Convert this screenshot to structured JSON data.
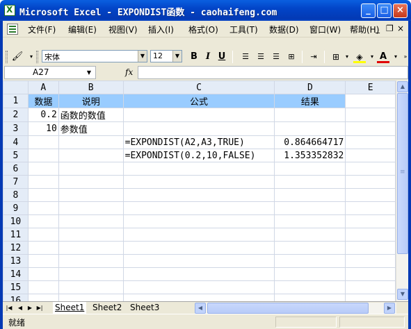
{
  "window": {
    "title": "Microsoft Excel - EXPONDIST函数 - caohaifeng.com",
    "minimize": "_",
    "maximize": "□",
    "close": "×"
  },
  "menu": {
    "items": [
      "文件(F)",
      "编辑(E)",
      "视图(V)",
      "插入(I)",
      "格式(O)",
      "工具(T)",
      "数据(D)",
      "窗口(W)",
      "帮助(H)"
    ],
    "doc_controls": [
      "_",
      "❐",
      "×"
    ]
  },
  "toolbar": {
    "font_name": "宋体",
    "font_size": "12",
    "bold": "B",
    "italic": "I",
    "underline": "U",
    "font_color_label": "A"
  },
  "formula_bar": {
    "name_box": "A27",
    "fx": "fx",
    "formula": ""
  },
  "sheet": {
    "columns": [
      "A",
      "B",
      "C",
      "D",
      "E"
    ],
    "rows": [
      [
        "数据",
        "说明",
        "公式",
        "结果",
        ""
      ],
      [
        "0.2",
        "函数的数值",
        "",
        "",
        ""
      ],
      [
        "10",
        "参数值",
        "",
        "",
        ""
      ],
      [
        "",
        "",
        "=EXPONDIST(A2,A3,TRUE)",
        "0.864664717",
        ""
      ],
      [
        "",
        "",
        "=EXPONDIST(0.2,10,FALSE)",
        "1.353352832",
        ""
      ],
      [
        "",
        "",
        "",
        "",
        ""
      ],
      [
        "",
        "",
        "",
        "",
        ""
      ],
      [
        "",
        "",
        "",
        "",
        ""
      ],
      [
        "",
        "",
        "",
        "",
        ""
      ],
      [
        "",
        "",
        "",
        "",
        ""
      ],
      [
        "",
        "",
        "",
        "",
        ""
      ],
      [
        "",
        "",
        "",
        "",
        ""
      ],
      [
        "",
        "",
        "",
        "",
        ""
      ],
      [
        "",
        "",
        "",
        "",
        ""
      ],
      [
        "",
        "",
        "",
        "",
        ""
      ],
      [
        "",
        "",
        "",
        "",
        ""
      ]
    ],
    "row_numbers": [
      "1",
      "2",
      "3",
      "4",
      "5",
      "6",
      "7",
      "8",
      "9",
      "10",
      "11",
      "12",
      "13",
      "14",
      "15",
      "16"
    ]
  },
  "tabs": [
    "Sheet1",
    "Sheet2",
    "Sheet3"
  ],
  "status": {
    "text": "就绪"
  },
  "colors": {
    "header_fill": "#99ccff",
    "title_bar": "#0245c8",
    "chrome": "#ece9d8"
  }
}
